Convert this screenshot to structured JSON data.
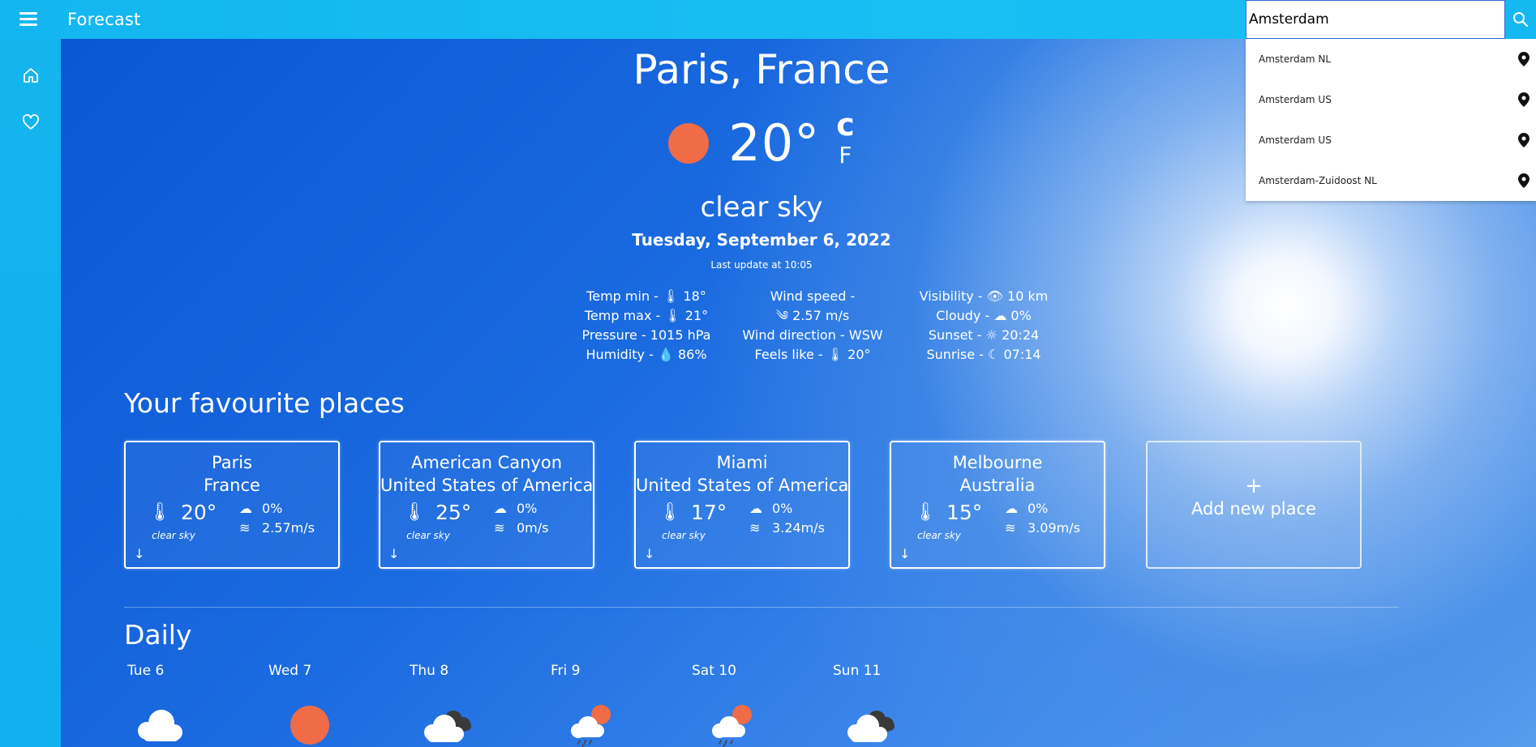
{
  "app": {
    "title": "Forecast"
  },
  "search": {
    "value": "Amsterdam",
    "placeholder": ""
  },
  "suggestions": [
    {
      "label": "Amsterdam NL"
    },
    {
      "label": "Amsterdam US"
    },
    {
      "label": "Amsterdam US"
    },
    {
      "label": "Amsterdam-Zuidoost NL"
    }
  ],
  "current": {
    "city": "Paris, France",
    "temp": "20°",
    "unit_c": "c",
    "unit_f": "F",
    "description": "clear sky",
    "date": "Tuesday, September 6, 2022",
    "last_update": "Last update at 10:05",
    "col1": [
      "Temp min - 🌡 18°",
      "Temp max - 🌡 21°",
      "Pressure - 1015 hPa",
      "Humidity - 💧 86%"
    ],
    "col2": [
      "Wind speed -",
      "༄ 2.57 m/s",
      "Wind direction - WSW",
      "Feels like - 🌡 20°"
    ],
    "col3": [
      "Visibility - 👁 10 km",
      "Cloudy - ☁ 0%",
      "Sunset - ☼ 20:24",
      "Sunrise - ☾ 07:14"
    ]
  },
  "favourites": {
    "title": "Your favourite places",
    "places": [
      {
        "city": "Paris",
        "country": "France",
        "temp": "20°",
        "sky": "clear sky",
        "cloud": "0%",
        "wind": "2.57m/s"
      },
      {
        "city": "American Canyon",
        "country": "United States of America",
        "temp": "25°",
        "sky": "clear sky",
        "cloud": "0%",
        "wind": "0m/s"
      },
      {
        "city": "Miami",
        "country": "United States of America",
        "temp": "17°",
        "sky": "clear sky",
        "cloud": "0%",
        "wind": "3.24m/s"
      },
      {
        "city": "Melbourne",
        "country": "Australia",
        "temp": "15°",
        "sky": "clear sky",
        "cloud": "0%",
        "wind": "3.09m/s"
      }
    ],
    "add_plus": "+",
    "add_label": "Add new place"
  },
  "daily": {
    "title": "Daily",
    "days": [
      {
        "label": "Tue 6",
        "icon": "cloud-icon"
      },
      {
        "label": "Wed 7",
        "icon": "sun-icon"
      },
      {
        "label": "Thu 8",
        "icon": "cloudy-icon"
      },
      {
        "label": "Fri 9",
        "icon": "rain-sun-icon"
      },
      {
        "label": "Sat 10",
        "icon": "rain-sun-icon"
      },
      {
        "label": "Sun 11",
        "icon": "cloudy-icon"
      }
    ]
  },
  "colors": {
    "topbar": "#13b6f0",
    "sun": "#ef6c47",
    "background": "#1e6fe0"
  },
  "icons": {
    "menu": "menu-icon",
    "home": "home-icon",
    "favourites": "heart-icon",
    "search": "search-icon",
    "pin": "location-pin-icon",
    "add": "plus-icon"
  }
}
